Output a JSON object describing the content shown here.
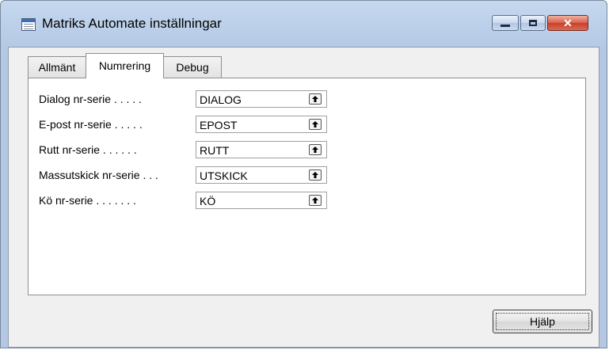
{
  "window": {
    "title": "Matriks Automate inställningar",
    "controls": {
      "minimize": "minimize",
      "maximize": "maximize",
      "close": "✕"
    }
  },
  "tabs": [
    {
      "label": "Allmänt",
      "active": false
    },
    {
      "label": "Numrering",
      "active": true
    },
    {
      "label": "Debug",
      "active": false
    }
  ],
  "fields": [
    {
      "label": "Dialog nr-serie . . . . .",
      "value": "DIALOG"
    },
    {
      "label": "E-post nr-serie . . . . .",
      "value": "EPOST"
    },
    {
      "label": "Rutt nr-serie . . . . . .",
      "value": "RUTT"
    },
    {
      "label": "Massutskick nr-serie . . .",
      "value": "UTSKICK"
    },
    {
      "label": "Kö nr-serie . . . . . . .",
      "value": "KÖ"
    }
  ],
  "buttons": {
    "help": "Hjälp"
  },
  "icons": {
    "app": "table-icon",
    "lookup": "lookup-arrow-icon"
  },
  "colors": {
    "titlebar": "#bcd0ea",
    "close": "#c8402a",
    "panel": "#ffffff",
    "client": "#f0f0f0"
  }
}
